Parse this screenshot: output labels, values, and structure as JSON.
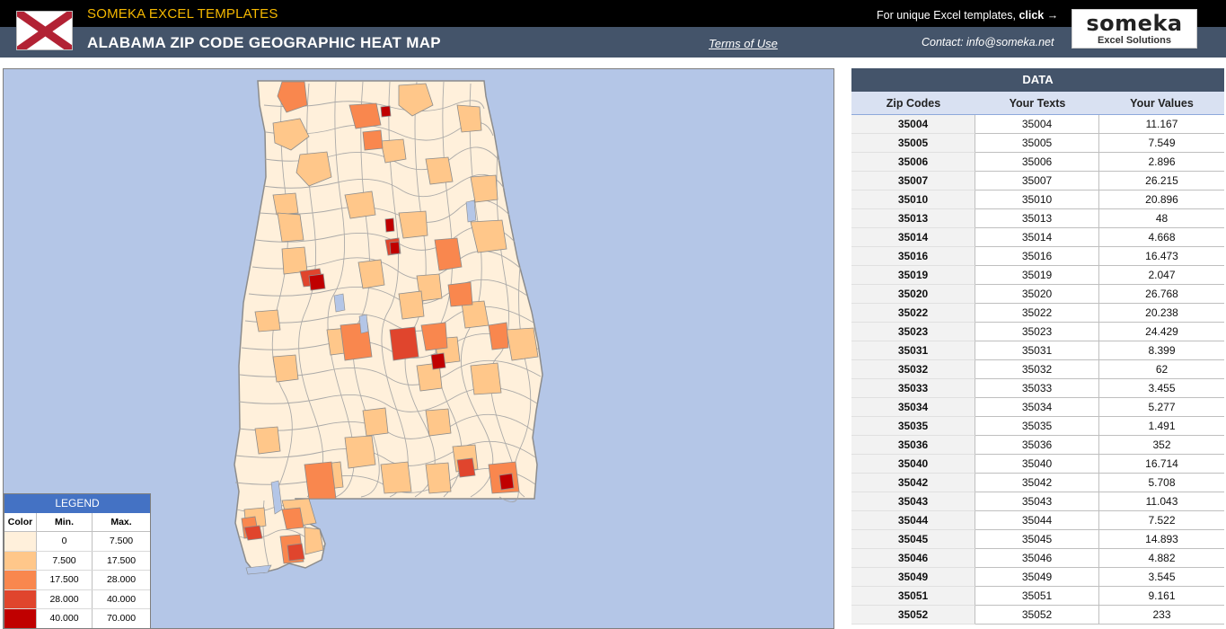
{
  "header": {
    "brand": "SOMEKA EXCEL TEMPLATES",
    "title": "ALABAMA ZIP CODE GEOGRAPHIC HEAT MAP",
    "terms_label": "Terms of Use",
    "promo_prefix": "For unique Excel templates,",
    "promo_click": "click →",
    "contact": "Contact: info@someka.net",
    "logo_word": "someka",
    "logo_sub": "Excel Solutions"
  },
  "legend": {
    "title": "LEGEND",
    "columns": [
      "Color",
      "Min.",
      "Max."
    ],
    "rows": [
      {
        "color": "#fff0db",
        "min": "0",
        "max": "7.500"
      },
      {
        "color": "#ffc78a",
        "min": "7.500",
        "max": "17.500"
      },
      {
        "color": "#f9874e",
        "min": "17.500",
        "max": "28.000"
      },
      {
        "color": "#e0452d",
        "min": "28.000",
        "max": "40.000"
      },
      {
        "color": "#c00000",
        "min": "40.000",
        "max": "70.000"
      }
    ]
  },
  "data_table": {
    "title": "DATA",
    "columns": [
      "Zip Codes",
      "Your Texts",
      "Your Values"
    ],
    "rows": [
      [
        "35004",
        "35004",
        "11.167"
      ],
      [
        "35005",
        "35005",
        "7.549"
      ],
      [
        "35006",
        "35006",
        "2.896"
      ],
      [
        "35007",
        "35007",
        "26.215"
      ],
      [
        "35010",
        "35010",
        "20.896"
      ],
      [
        "35013",
        "35013",
        "48"
      ],
      [
        "35014",
        "35014",
        "4.668"
      ],
      [
        "35016",
        "35016",
        "16.473"
      ],
      [
        "35019",
        "35019",
        "2.047"
      ],
      [
        "35020",
        "35020",
        "26.768"
      ],
      [
        "35022",
        "35022",
        "20.238"
      ],
      [
        "35023",
        "35023",
        "24.429"
      ],
      [
        "35031",
        "35031",
        "8.399"
      ],
      [
        "35032",
        "35032",
        "62"
      ],
      [
        "35033",
        "35033",
        "3.455"
      ],
      [
        "35034",
        "35034",
        "5.277"
      ],
      [
        "35035",
        "35035",
        "1.491"
      ],
      [
        "35036",
        "35036",
        "352"
      ],
      [
        "35040",
        "35040",
        "16.714"
      ],
      [
        "35042",
        "35042",
        "5.708"
      ],
      [
        "35043",
        "35043",
        "11.043"
      ],
      [
        "35044",
        "35044",
        "7.522"
      ],
      [
        "35045",
        "35045",
        "14.893"
      ],
      [
        "35046",
        "35046",
        "4.882"
      ],
      [
        "35049",
        "35049",
        "3.545"
      ],
      [
        "35051",
        "35051",
        "9.161"
      ],
      [
        "35052",
        "35052",
        "233"
      ]
    ]
  },
  "map": {
    "ocean_color": "#b4c6e7",
    "base_color": "#fff0db",
    "border_color": "#8c8c8c"
  }
}
